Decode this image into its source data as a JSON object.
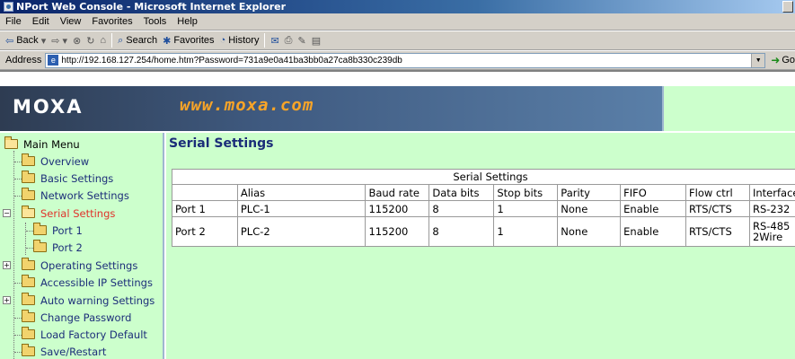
{
  "window": {
    "title": "NPort Web Console - Microsoft Internet Explorer"
  },
  "menubar": {
    "items": [
      "File",
      "Edit",
      "View",
      "Favorites",
      "Tools",
      "Help"
    ]
  },
  "toolbar": {
    "back": "Back",
    "search": "Search",
    "favorites": "Favorites",
    "history": "History"
  },
  "address": {
    "label": "Address",
    "url": "http://192.168.127.254/home.htm?Password=731a9e0a41ba3bb0a27ca8b330c239db",
    "go": "Go"
  },
  "banner": {
    "logo": "MOXA",
    "url": "www.moxa.com"
  },
  "sidebar": {
    "root": "Main Menu",
    "items": [
      {
        "label": "Overview"
      },
      {
        "label": "Basic Settings"
      },
      {
        "label": "Network Settings"
      },
      {
        "label": "Serial Settings"
      },
      {
        "label": "Port 1"
      },
      {
        "label": "Port 2"
      },
      {
        "label": "Operating Settings"
      },
      {
        "label": "Accessible IP Settings"
      },
      {
        "label": "Auto warning Settings"
      },
      {
        "label": "Change Password"
      },
      {
        "label": "Load Factory Default"
      },
      {
        "label": "Save/Restart"
      }
    ]
  },
  "main": {
    "title": "Serial Settings",
    "table": {
      "caption": "Serial Settings",
      "headers": [
        "",
        "Alias",
        "Baud rate",
        "Data bits",
        "Stop bits",
        "Parity",
        "FIFO",
        "Flow ctrl",
        "Interface"
      ],
      "rows": [
        [
          "Port 1",
          "PLC-1",
          "115200",
          "8",
          "1",
          "None",
          "Enable",
          "RTS/CTS",
          "RS-232"
        ],
        [
          "Port 2",
          "PLC-2",
          "115200",
          "8",
          "1",
          "None",
          "Enable",
          "RTS/CTS",
          "RS-485 2Wire"
        ]
      ]
    }
  },
  "colors": {
    "panel_bg": "#ccffcc",
    "title_blue": "#1a2c78",
    "active_red": "#e0322b",
    "banner_orange": "#f7a428"
  }
}
